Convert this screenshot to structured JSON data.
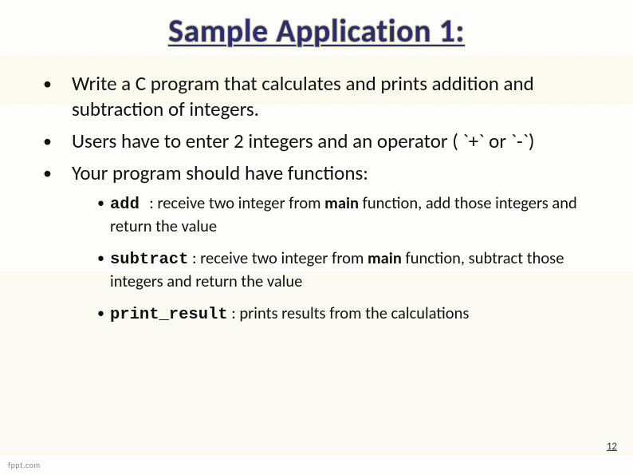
{
  "title": "Sample Application 1:",
  "bullets": [
    "Write a C program that calculates and prints addition and subtraction of integers.",
    "Users have to enter 2 integers and an operator ( `+` or `-`)",
    "Your program should have functions:"
  ],
  "sub": [
    {
      "code": "add ",
      "rest1": ": receive two integer from ",
      "bold": "main",
      "rest2": " function, add those integers and return the value"
    },
    {
      "code": "subtract",
      "rest1": " : receive two integer from ",
      "bold": "main",
      "rest2": " function, subtract those integers and return the value"
    },
    {
      "code": "print_result",
      "rest1": " : prints results from the calculations",
      "bold": "",
      "rest2": ""
    }
  ],
  "pageNumber": "12",
  "brand": "fppt.com"
}
